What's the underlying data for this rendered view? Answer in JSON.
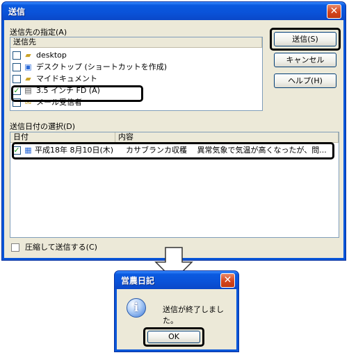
{
  "main": {
    "title": "送信",
    "close_glyph": "✕",
    "dest_group_label": "送信先の指定(A)",
    "dest_col_header": "送信先",
    "dest_items": [
      {
        "label": "desktop",
        "icon": "folder-icon",
        "checked": false
      },
      {
        "label": "デスクトップ (ショートカットを作成)",
        "icon": "desktop-icon",
        "checked": false
      },
      {
        "label": "マイドキュメント",
        "icon": "folder-icon",
        "checked": false
      },
      {
        "label": "3.5 インチ FD (A)",
        "icon": "floppy-icon",
        "checked": true
      },
      {
        "label": "メール受信者",
        "icon": "mail-icon",
        "checked": false
      }
    ],
    "date_group_label": "送信日付の選択(D)",
    "date_col_date": "日付",
    "date_col_content": "内容",
    "date_rows": [
      {
        "date": "平成18年 8月10日(木)",
        "content": "カサブランカ収穫　 異常気象で気温が高くなったが、問...",
        "checked": true
      }
    ],
    "compress_label": "圧縮して送信する(C)",
    "buttons": {
      "send": "送信(S)",
      "cancel": "キャンセル",
      "help": "ヘルプ(H)"
    }
  },
  "msgbox": {
    "title": "営農日記",
    "message": "送信が終了しました。",
    "ok": "OK",
    "info_glyph": "i"
  },
  "colors": {
    "titlebar": "#0a52d8",
    "dialog_bg": "#ece9d8",
    "close": "#d4441c",
    "check": "#21a121"
  }
}
